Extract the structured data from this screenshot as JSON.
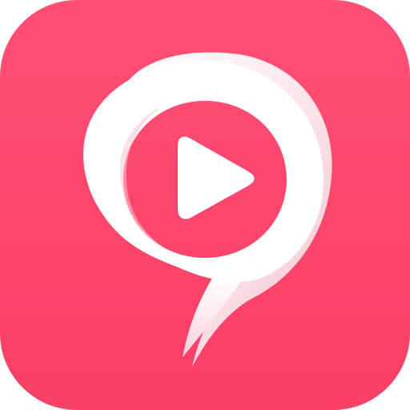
{
  "app_icon": {
    "glyph": "9",
    "icon_name": "video-play-nine-logo-icon",
    "colors": {
      "background_top": "#ff4f74",
      "background_bottom": "#f93f66",
      "logo_white": "#ffffff",
      "logo_shadow": "#f4c7d0",
      "play_triangle": "#ffffff"
    }
  }
}
